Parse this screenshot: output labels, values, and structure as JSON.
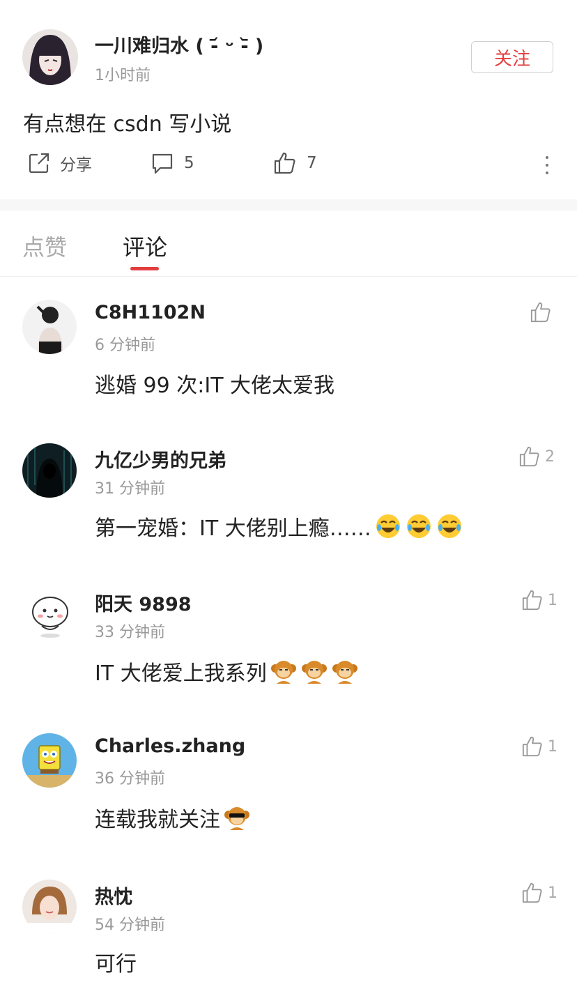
{
  "post": {
    "author": "一川难归水 ( -᷄ ᵕ -᷅ )",
    "time": "1小时前",
    "follow_label": "关注",
    "content": "有点想在 csdn 写小说",
    "share_label": "分享",
    "comment_count": "5",
    "like_count": "7"
  },
  "tabs": [
    {
      "label": "点赞"
    },
    {
      "label": "评论"
    }
  ],
  "comments": [
    {
      "name": "C8H1102N",
      "time": "6 分钟前",
      "text": "逃婚 99 次:IT 大佬太爱我",
      "likes": "",
      "emoji": []
    },
    {
      "name": "九亿少男的兄弟",
      "time": "31 分钟前",
      "text": "第一宠婚：IT 大佬别上瘾……",
      "likes": "2",
      "emoji": [
        "laugh-cry-emoji",
        "laugh-cry-emoji",
        "laugh-cry-emoji"
      ]
    },
    {
      "name": "阳天 9898",
      "time": "33 分钟前",
      "text": "IT 大佬爱上我系列",
      "likes": "1",
      "emoji": [
        "monkey-emoji",
        "monkey-emoji",
        "monkey-emoji"
      ]
    },
    {
      "name": "Charles.zhang",
      "time": "36 分钟前",
      "text": "连载我就关注",
      "likes": "1",
      "emoji": [
        "cool-monkey-emoji"
      ]
    },
    {
      "name": "热忱",
      "time": "54 分钟前",
      "text": "可行",
      "likes": "1",
      "emoji": []
    }
  ],
  "colors": {
    "accent": "#e33e3e",
    "muted": "#999999"
  }
}
